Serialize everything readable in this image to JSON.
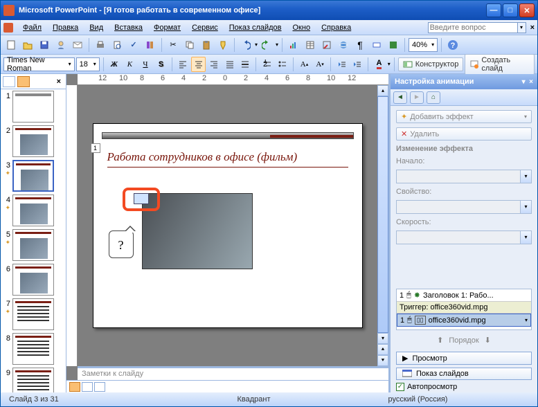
{
  "title": "Microsoft PowerPoint - [Я готов работать в современном офисе]",
  "menu": {
    "file": "Файл",
    "edit": "Правка",
    "view": "Вид",
    "insert": "Вставка",
    "format": "Формат",
    "service": "Сервис",
    "slideshow": "Показ слайдов",
    "window": "Окно",
    "help": "Справка"
  },
  "helpbox": {
    "placeholder": "Введите вопрос",
    "x": "×"
  },
  "zoom": "40%",
  "fontname": "Times New Roman",
  "fontsize": "18",
  "constructor_label": "Конструктор",
  "newslide_label": "Создать слайд",
  "thumbs": [
    1,
    2,
    3,
    4,
    5,
    6,
    7,
    8,
    9
  ],
  "active_thumb": 3,
  "slide_tag": "1",
  "slide_title": "Работа сотрудников в офисе (фильм)",
  "callout": "?",
  "taskpane": {
    "title": "Настройка анимации",
    "add_effect": "Добавить эффект",
    "remove": "Удалить",
    "change_header": "Изменение эффекта",
    "start_label": "Начало:",
    "property_label": "Свойство:",
    "speed_label": "Скорость:",
    "list": {
      "item1_num": "1",
      "item1_text": "Заголовок 1: Рабо...",
      "trigger": "Триггер: office360vid.mpg",
      "item2_num": "1",
      "item2_text": "office360vid.mpg"
    },
    "order_label": "Порядок",
    "preview": "Просмотр",
    "slideshow": "Показ слайдов",
    "autopreview": "Автопросмотр"
  },
  "notes": "Заметки к слайду",
  "status": {
    "pos": "Слайд 3 из 31",
    "layout": "Квадрант",
    "lang": "русский (Россия)"
  },
  "chart_data": null
}
